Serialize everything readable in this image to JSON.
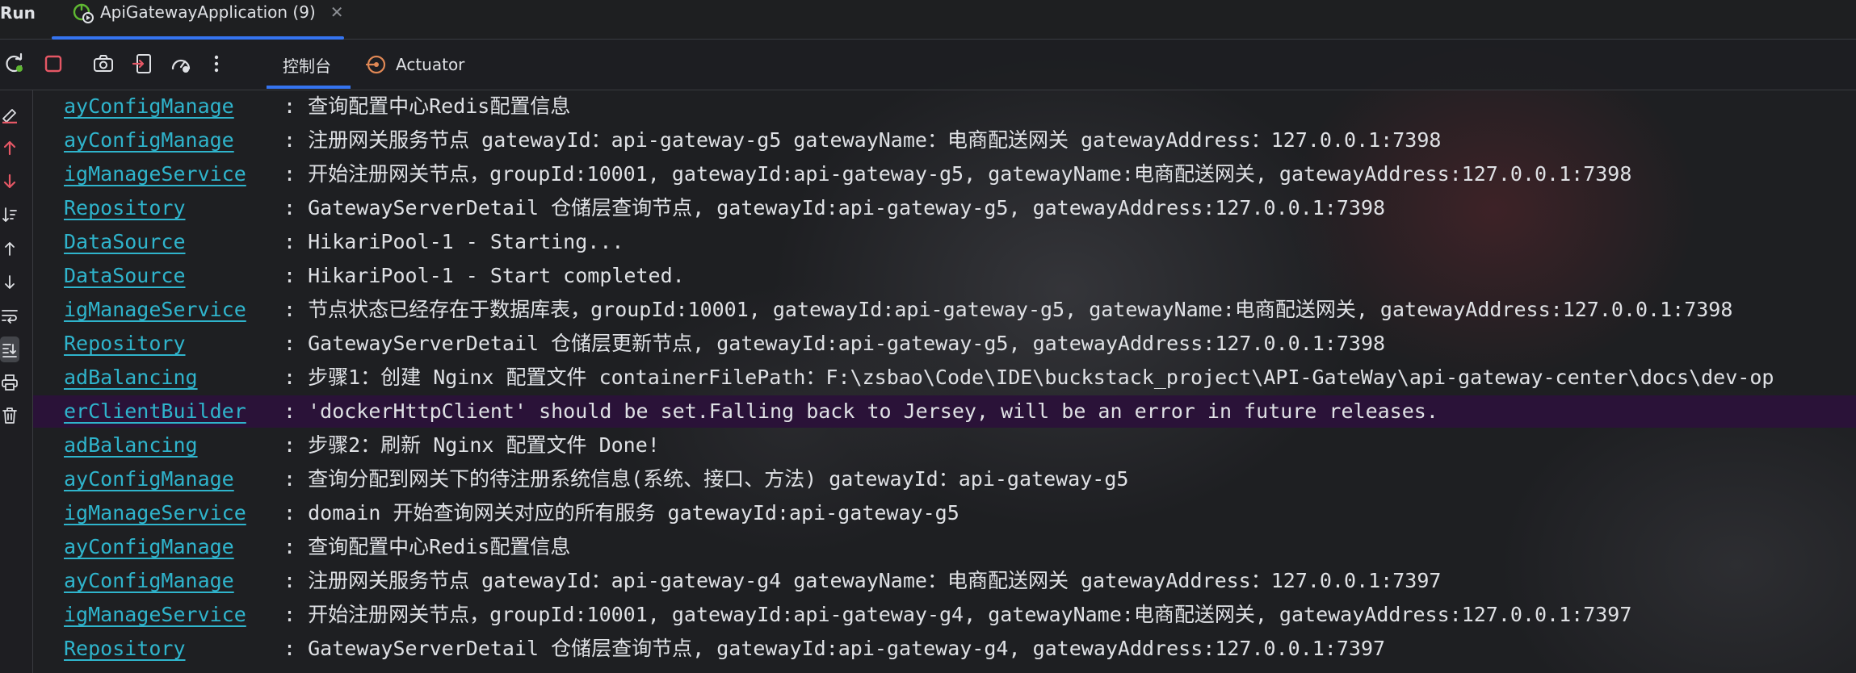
{
  "header": {
    "run_label": "Run",
    "tab_title": "ApiGatewayApplication (9)",
    "tab_close": "✕"
  },
  "toolbar": {
    "buttons": [
      "rerun-icon",
      "stop-icon",
      "screenshot-icon",
      "exit-icon",
      "dashboard-icon",
      "more-icon"
    ],
    "tabs": [
      {
        "label": "控制台"
      },
      {
        "label": "Actuator"
      }
    ]
  },
  "gutter": {
    "buttons": [
      "clear-all-icon",
      "previous-occurrence-icon",
      "next-occurrence-icon",
      "sort-icon",
      "scroll-up-icon",
      "scroll-down-icon",
      "soft-wrap-icon",
      "scroll-to-end-icon",
      "print-icon",
      "trash-icon"
    ]
  },
  "colors": {
    "logger": "#2fb4cc",
    "text": "#dfe1e5",
    "accent": "#3574f0",
    "stop": "#e55765",
    "warn_line_bg": "#2a1238"
  },
  "console": {
    "lines": [
      {
        "logger": "ayConfigManage",
        "message": ": 查询配置中心Redis配置信息"
      },
      {
        "logger": "ayConfigManage",
        "message": ": 注册网关服务节点 gatewayId：api-gateway-g5 gatewayName：电商配送网关 gatewayAddress：127.0.0.1:7398"
      },
      {
        "logger": "igManageService",
        "message": ": 开始注册网关节点，groupId:10001, gatewayId:api-gateway-g5, gatewayName:电商配送网关, gatewayAddress:127.0.0.1:7398"
      },
      {
        "logger": "Repository",
        "message": ": GatewayServerDetail 仓储层查询节点, gatewayId:api-gateway-g5, gatewayAddress:127.0.0.1:7398"
      },
      {
        "logger": "DataSource",
        "message": ": HikariPool-1 - Starting..."
      },
      {
        "logger": "DataSource",
        "message": ": HikariPool-1 - Start completed."
      },
      {
        "logger": "igManageService",
        "message": ": 节点状态已经存在于数据库表，groupId:10001, gatewayId:api-gateway-g5, gatewayName:电商配送网关, gatewayAddress:127.0.0.1:7398"
      },
      {
        "logger": "Repository",
        "message": ": GatewayServerDetail 仓储层更新节点, gatewayId:api-gateway-g5, gatewayAddress:127.0.0.1:7398"
      },
      {
        "logger": "adBalancing",
        "message": ": 步骤1：创建 Nginx 配置文件 containerFilePath：F:\\zsbao\\Code\\IDE\\buckstack_project\\API-GateWay\\api-gateway-center\\docs\\dev-op"
      },
      {
        "logger": "erClientBuilder",
        "message": ": 'dockerHttpClient' should be set.Falling back to Jersey, will be an error in future releases.",
        "highlight": true
      },
      {
        "logger": "adBalancing",
        "message": ": 步骤2：刷新 Nginx 配置文件 Done!"
      },
      {
        "logger": "ayConfigManage",
        "message": ": 查询分配到网关下的待注册系统信息(系统、接口、方法) gatewayId：api-gateway-g5"
      },
      {
        "logger": "igManageService",
        "message": ": domain 开始查询网关对应的所有服务 gatewayId:api-gateway-g5"
      },
      {
        "logger": "ayConfigManage",
        "message": ": 查询配置中心Redis配置信息"
      },
      {
        "logger": "ayConfigManage",
        "message": ": 注册网关服务节点 gatewayId：api-gateway-g4 gatewayName：电商配送网关 gatewayAddress：127.0.0.1:7397"
      },
      {
        "logger": "igManageService",
        "message": ": 开始注册网关节点，groupId:10001, gatewayId:api-gateway-g4, gatewayName:电商配送网关, gatewayAddress:127.0.0.1:7397"
      },
      {
        "logger": "Repository",
        "message": ": GatewayServerDetail 仓储层查询节点, gatewayId:api-gateway-g4, gatewayAddress:127.0.0.1:7397"
      }
    ]
  }
}
